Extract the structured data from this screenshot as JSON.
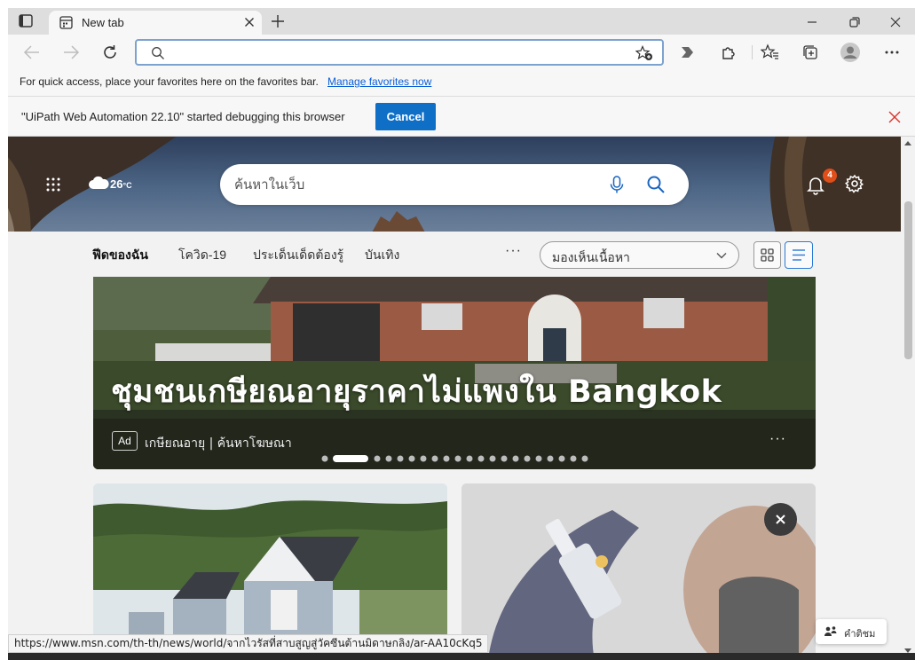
{
  "tab": {
    "title": "New tab"
  },
  "address_bar": {
    "value": "",
    "placeholder": ""
  },
  "favorites_bar": {
    "message": "For quick access, place your favorites here on the favorites bar.",
    "link": "Manage favorites now"
  },
  "infobar": {
    "message": "\"UiPath Web Automation 22.10\" started debugging this browser",
    "cancel_label": "Cancel"
  },
  "weather": {
    "temp": "26",
    "unit": "°C"
  },
  "web_search": {
    "placeholder": "ค้นหาในเว็บ"
  },
  "notifications": {
    "count": "4"
  },
  "feed_nav": {
    "tabs": [
      "ฟีดของฉัน",
      "โควิด-19",
      "ประเด็นเด็ดต้องรู้",
      "บันเทิง"
    ],
    "more": "···",
    "view_select": "มองเห็นเนื้อหา"
  },
  "ad": {
    "headline": "ชุมชนเกษียณอายุราคาไม่แพงใน Bangkok",
    "badge": "Ad",
    "source": "เกษียณอายุ | ค้นหาโฆษณา",
    "more": "···",
    "carousel": {
      "total": 22,
      "active": 2
    }
  },
  "feedback": {
    "label": "คำติชม"
  },
  "status_url": "https://www.msn.com/th-th/news/world/จากไวรัสที่สาบสูญสู่วัคซีนต้านมิดาษกลิง/ar-AA10cKq5",
  "colors": {
    "accent": "#0f6fc6",
    "badge": "#e04e1a",
    "link": "#0b5ed7"
  }
}
